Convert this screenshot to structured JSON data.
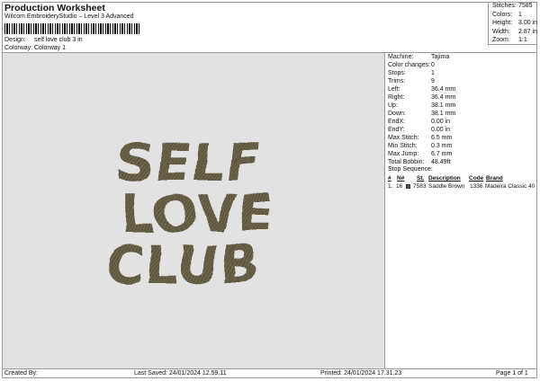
{
  "header": {
    "title": "Production Worksheet",
    "subtitle": "Wilcom EmbroideryStudio – Level 3 Advanced",
    "design_label": "Design:",
    "design_value": "self love club 3 in",
    "colorway_label": "Colorway:",
    "colorway_value": "Colorway 1"
  },
  "stats": [
    {
      "label": "Stitches:",
      "value": "7585"
    },
    {
      "label": "Colors:",
      "value": "1"
    },
    {
      "label": "Height:",
      "value": "3.00 in"
    },
    {
      "label": "Width:",
      "value": "2.87 in"
    },
    {
      "label": "Zoom:",
      "value": "1:1"
    }
  ],
  "machine_info": [
    {
      "label": "Machine:",
      "value": "Tajima"
    },
    {
      "label": "Color changes:",
      "value": "0"
    },
    {
      "label": "Stops:",
      "value": "1"
    },
    {
      "label": "Trims:",
      "value": "9"
    },
    {
      "label": "Left:",
      "value": "36.4 mm"
    },
    {
      "label": "Right:",
      "value": "36.4 mm"
    },
    {
      "label": "Up:",
      "value": "38.1 mm"
    },
    {
      "label": "Down:",
      "value": "38.1 mm"
    },
    {
      "label": "EndX:",
      "value": "0.00 in"
    },
    {
      "label": "EndY:",
      "value": "0.00 in"
    },
    {
      "label": "Max Stitch:",
      "value": "6.5 mm"
    },
    {
      "label": "Min Stitch:",
      "value": "0.3 mm"
    },
    {
      "label": "Max Jump:",
      "value": "6.7 mm"
    },
    {
      "label": "Total Bobbin:",
      "value": "48.49ft"
    }
  ],
  "stop_sequence": {
    "title": "Stop Sequence:",
    "headers": {
      "num": "#",
      "n": "N#",
      "st": "St.",
      "desc": "Description",
      "code": "Code",
      "brand": "Brand"
    },
    "rows": [
      {
        "num": "1.",
        "n": "16",
        "st": "7583",
        "desc": "Saddle Brown",
        "code": "1336",
        "brand": "Madeira Classic 40",
        "color": "#6b4a36"
      }
    ]
  },
  "design": {
    "lines": [
      "SELF",
      "LOVE",
      "CLUB"
    ],
    "thread_color": "#5e5640",
    "stitch_color": "#8a7f5e"
  },
  "footer": {
    "created": "Created By:",
    "saved": "Last Saved: 24/01/2024 12.59.11",
    "printed": "Printed: 24/01/2024 17.31.23",
    "page": "Page 1 of 1"
  }
}
